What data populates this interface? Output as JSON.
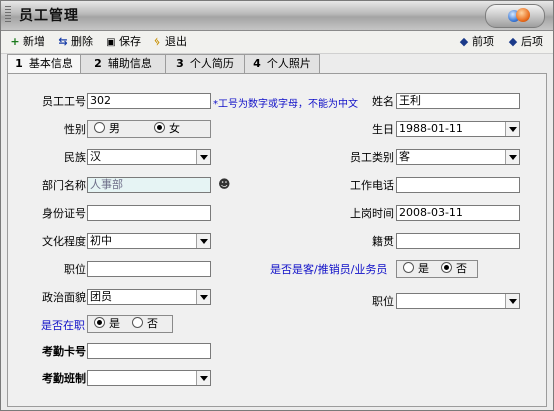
{
  "window": {
    "title": "员工管理"
  },
  "toolbar": {
    "add": "新增",
    "delete": "删除",
    "save": "保存",
    "exit": "退出",
    "prev": "前项",
    "next": "后项"
  },
  "tabs": [
    {
      "num": "1",
      "label": "基本信息"
    },
    {
      "num": "2",
      "label": "辅助信息"
    },
    {
      "num": "3",
      "label": "个人简历"
    },
    {
      "num": "4",
      "label": "个人照片"
    }
  ],
  "form": {
    "emp_no": {
      "label": "员工工号",
      "value": "302",
      "hint": "*工号为数字或字母，不能为中文"
    },
    "name": {
      "label": "姓名",
      "value": "王利"
    },
    "gender": {
      "label": "性别",
      "male": "男",
      "female": "女",
      "selected": "女"
    },
    "birthday": {
      "label": "生日",
      "value": "1988-01-11"
    },
    "ethnicity": {
      "label": "民族",
      "value": "汉"
    },
    "emp_type": {
      "label": "员工类别",
      "value": "客"
    },
    "dept": {
      "label": "部门名称",
      "value": "人事部"
    },
    "work_phone": {
      "label": "工作电话",
      "value": ""
    },
    "id_no": {
      "label": "身份证号",
      "value": ""
    },
    "hire_date": {
      "label": "上岗时间",
      "value": "2008-03-11"
    },
    "education": {
      "label": "文化程度",
      "value": "初中"
    },
    "native_place": {
      "label": "籍贯",
      "value": ""
    },
    "position": {
      "label": "职位",
      "value": ""
    },
    "is_sales": {
      "label": "是否是客/推销员/业务员",
      "yes": "是",
      "no": "否",
      "selected": "否"
    },
    "political": {
      "label": "政治面貌",
      "value": "团员"
    },
    "position2": {
      "label": "职位",
      "value": ""
    },
    "on_job": {
      "label": "是否在职",
      "yes": "是",
      "no": "否",
      "selected": "是"
    },
    "attendance_card": {
      "label": "考勤卡号",
      "value": ""
    },
    "attendance_shift": {
      "label": "考勤班制",
      "value": ""
    }
  }
}
